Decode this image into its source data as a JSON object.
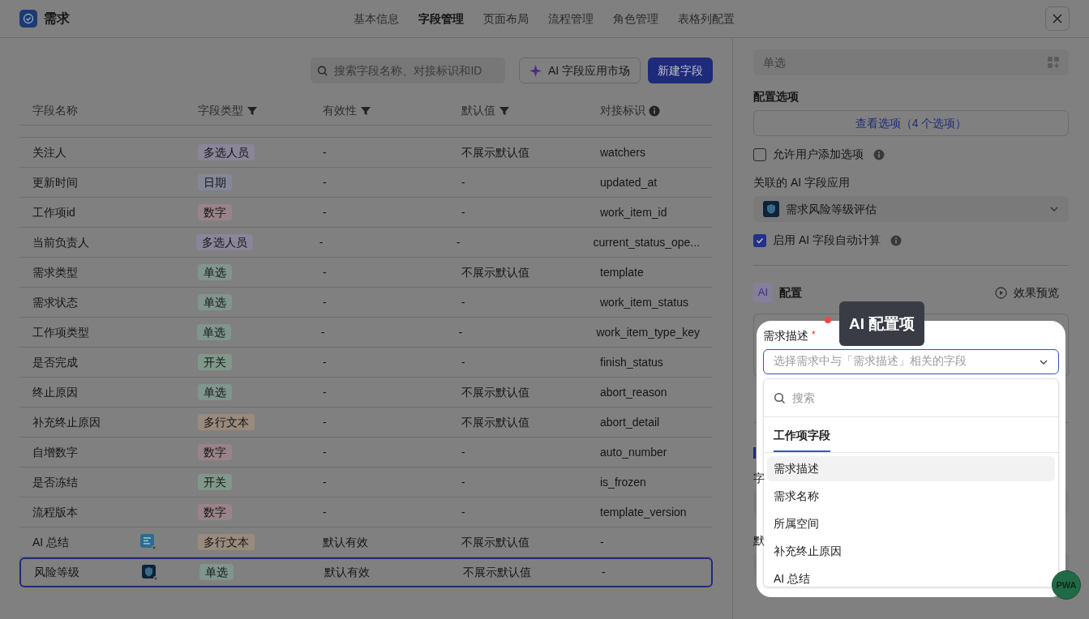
{
  "header": {
    "title": "需求",
    "tabs": [
      {
        "label": "基本信息",
        "selected": false
      },
      {
        "label": "字段管理",
        "selected": true
      },
      {
        "label": "页面布局",
        "selected": false
      },
      {
        "label": "流程管理",
        "selected": false
      },
      {
        "label": "角色管理",
        "selected": false
      },
      {
        "label": "表格列配置",
        "selected": false
      }
    ]
  },
  "toolbar": {
    "search_placeholder": "搜索字段名称、对接标识和ID",
    "market_button": "AI 字段应用市场",
    "new_button": "新建字段"
  },
  "table": {
    "columns": [
      {
        "label": "字段名称",
        "filter": false,
        "info": false
      },
      {
        "label": "字段类型",
        "filter": true,
        "info": false
      },
      {
        "label": "有效性",
        "filter": true,
        "info": false
      },
      {
        "label": "默认值",
        "filter": true,
        "info": false
      },
      {
        "label": "对接标识",
        "filter": false,
        "info": true
      }
    ],
    "rows": [
      {
        "name": "关注人",
        "type": "多选人员",
        "color": "#8a8598",
        "validity": "-",
        "default": "不展示默认值",
        "key": "watchers",
        "selected": false
      },
      {
        "name": "更新时间",
        "type": "日期",
        "color": "#858799",
        "validity": "-",
        "default": "-",
        "key": "updated_at",
        "selected": false
      },
      {
        "name": "工作项id",
        "type": "数字",
        "color": "#998389",
        "validity": "-",
        "default": "-",
        "key": "work_item_id",
        "selected": false
      },
      {
        "name": "当前负责人",
        "type": "多选人员",
        "color": "#8a8598",
        "validity": "-",
        "default": "-",
        "key": "current_status_ope...",
        "selected": false
      },
      {
        "name": "需求类型",
        "type": "单选",
        "color": "#7f958e",
        "validity": "-",
        "default": "不展示默认值",
        "key": "template",
        "selected": false
      },
      {
        "name": "需求状态",
        "type": "单选",
        "color": "#7f958e",
        "validity": "-",
        "default": "-",
        "key": "work_item_status",
        "selected": false
      },
      {
        "name": "工作项类型",
        "type": "单选",
        "color": "#7f958e",
        "validity": "-",
        "default": "-",
        "key": "work_item_type_key",
        "selected": false
      },
      {
        "name": "是否完成",
        "type": "开关",
        "color": "#80988a",
        "validity": "-",
        "default": "-",
        "key": "finish_status",
        "selected": false
      },
      {
        "name": "终止原因",
        "type": "单选",
        "color": "#7f958e",
        "validity": "-",
        "default": "不展示默认值",
        "key": "abort_reason",
        "selected": false
      },
      {
        "name": "补充终止原因",
        "type": "多行文本",
        "color": "#9a8a7c",
        "validity": "-",
        "default": "不展示默认值",
        "key": "abort_detail",
        "selected": false
      },
      {
        "name": "自增数字",
        "type": "数字",
        "color": "#998389",
        "validity": "-",
        "default": "-",
        "key": "auto_number",
        "selected": false
      },
      {
        "name": "是否冻结",
        "type": "开关",
        "color": "#80988a",
        "validity": "-",
        "default": "-",
        "key": "is_frozen",
        "selected": false
      },
      {
        "name": "流程版本",
        "type": "数字",
        "color": "#998389",
        "validity": "-",
        "default": "-",
        "key": "template_version",
        "selected": false
      },
      {
        "name": "AI 总结",
        "kind": "ai_text",
        "type": "多行文本",
        "color": "#9a8a7c",
        "validity": "默认有效",
        "default": "不展示默认值",
        "key": "-",
        "selected": false
      },
      {
        "name": "风险等级",
        "kind": "ai_risk",
        "type": "单选",
        "color": "#7f958e",
        "validity": "默认有效",
        "default": "不展示默认值",
        "key": "-",
        "selected": true
      }
    ]
  },
  "panel": {
    "type_value": "单选",
    "options_label": "配置选项",
    "options_button": "查看选项（4 个选项）",
    "allow_add": {
      "label": "允许用户添加选项",
      "checked": false
    },
    "app_label": "关联的 AI 字段应用",
    "app_value": "需求风险等级评估",
    "auto_calc": {
      "label": "启用 AI 字段自动计算",
      "checked": true
    },
    "ai_badge": "AI",
    "config_title": "配置",
    "preview": "效果预览",
    "label_a": "字",
    "label_b": "默"
  },
  "popup": {
    "tooltip": "AI 配置项",
    "field_label": "需求描述",
    "required_mark": "*",
    "select_placeholder": "选择需求中与「需求描述」相关的字段",
    "search_placeholder": "搜索",
    "tabs": [
      {
        "label": "工作项字段",
        "selected": true
      }
    ],
    "items": [
      {
        "label": "需求描述",
        "selected": true
      },
      {
        "label": "需求名称",
        "selected": false
      },
      {
        "label": "所属空间",
        "selected": false
      },
      {
        "label": "补充终止原因",
        "selected": false
      },
      {
        "label": "AI 总结",
        "selected": false
      }
    ]
  },
  "badge": "PWA"
}
